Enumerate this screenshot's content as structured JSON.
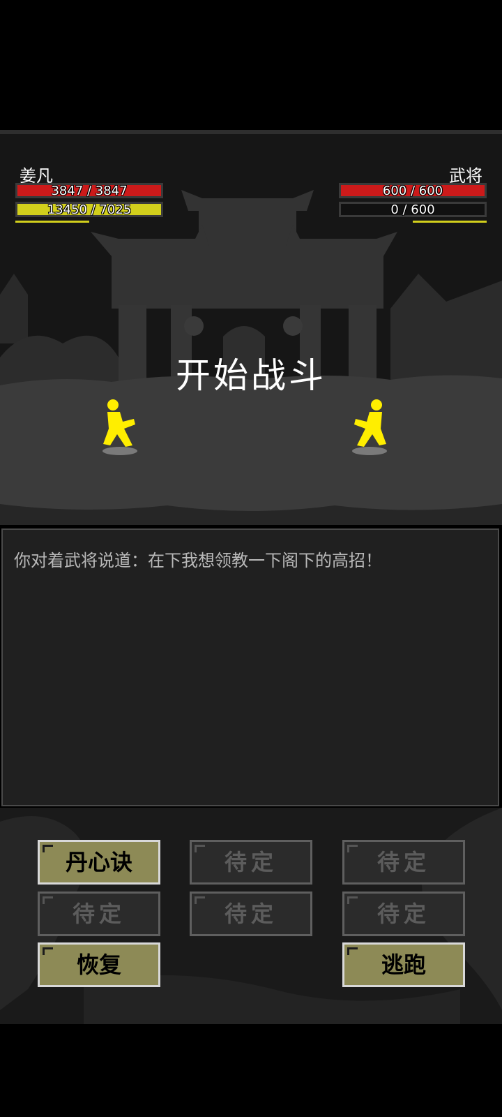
{
  "player": {
    "name": "姜凡",
    "hp_text": "3847 / 3847",
    "hp_fraction": 1.0,
    "mp_text": "13450 / 7025",
    "mp_fraction": 1.0,
    "charge_fraction": 0.5
  },
  "enemy": {
    "name": "武将",
    "hp_text": "600 / 600",
    "hp_fraction": 1.0,
    "mp_text": "0 / 600",
    "mp_fraction": 0.0,
    "charge_fraction": 0.5
  },
  "battle_title": "开始战斗",
  "log": {
    "lines": [
      "你对着武将说道：在下我想领教一下阁下的高招！"
    ]
  },
  "skills": [
    {
      "label": "丹心诀",
      "state": "active"
    },
    {
      "label": "待定",
      "state": "disabled"
    },
    {
      "label": "待定",
      "state": "disabled"
    },
    {
      "label": "待定",
      "state": "disabled"
    },
    {
      "label": "待定",
      "state": "disabled"
    },
    {
      "label": "待定",
      "state": "disabled"
    }
  ],
  "actions": {
    "recover": "恢复",
    "flee": "逃跑"
  },
  "colors": {
    "hp": "#cc1a1a",
    "mp": "#d2cf1c",
    "fighter": "#ffee00"
  }
}
